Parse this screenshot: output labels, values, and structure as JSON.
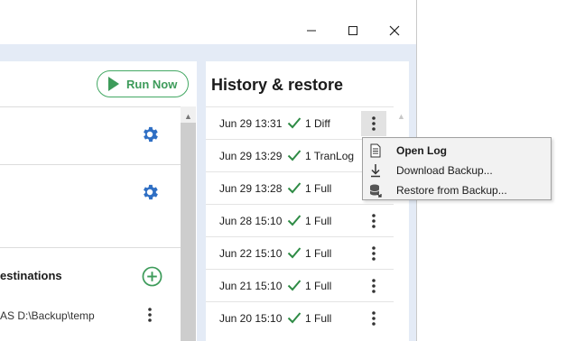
{
  "window": {
    "controls": {
      "minimize_icon": "minimize-icon",
      "maximize_icon": "maximize-icon",
      "close_icon": "close-icon"
    }
  },
  "left_panel": {
    "run_now_label": "Run Now",
    "destinations_title": "estinations",
    "destination_text": "AS  D:\\Backup\\temp"
  },
  "history": {
    "title": "History & restore",
    "rows": [
      {
        "date": "Jun 29 13:31",
        "type": "1 Diff"
      },
      {
        "date": "Jun 29 13:29",
        "type": "1 TranLog"
      },
      {
        "date": "Jun 29 13:28",
        "type": "1 Full"
      },
      {
        "date": "Jun 28 15:10",
        "type": "1 Full"
      },
      {
        "date": "Jun 22 15:10",
        "type": "1 Full"
      },
      {
        "date": "Jun 21 15:10",
        "type": "1 Full"
      },
      {
        "date": "Jun 20 15:10",
        "type": "1 Full"
      }
    ]
  },
  "context_menu": {
    "items": [
      {
        "label": "Open Log",
        "icon": "document-icon"
      },
      {
        "label": "Download Backup...",
        "icon": "download-icon"
      },
      {
        "label": "Restore from Backup...",
        "icon": "database-restore-icon"
      }
    ]
  },
  "colors": {
    "accent_green": "#3d9b5a",
    "gear_blue": "#2f6fc4",
    "background_blue": "#e4ebf6"
  }
}
